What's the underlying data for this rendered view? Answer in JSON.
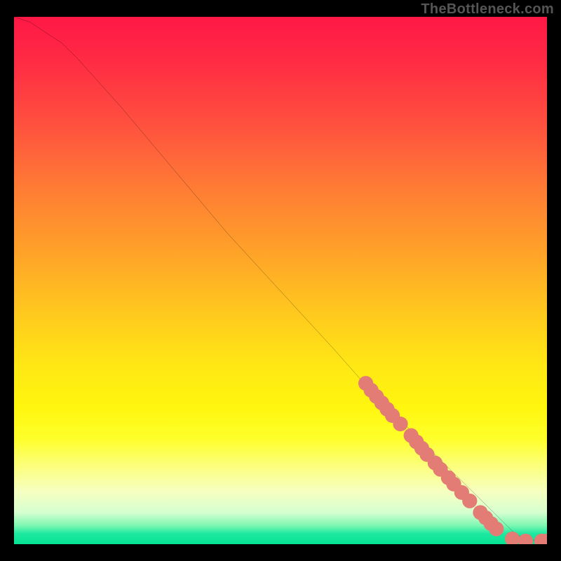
{
  "watermark": "TheBottleneck.com",
  "chart_data": {
    "type": "line",
    "title": "",
    "xlabel": "",
    "ylabel": "",
    "xlim": [
      0,
      100
    ],
    "ylim": [
      0,
      100
    ],
    "grid": false,
    "legend": false,
    "series": [
      {
        "name": "curve",
        "kind": "line",
        "color": "#000000",
        "x": [
          0,
          3,
          6,
          9,
          12,
          20,
          30,
          40,
          50,
          60,
          67,
          70,
          73,
          76,
          79,
          82,
          85,
          88,
          90,
          92,
          94,
          96,
          98,
          100
        ],
        "y": [
          100,
          99,
          97,
          95,
          92,
          83,
          71,
          59,
          48,
          37,
          29,
          26,
          23,
          20,
          17,
          14,
          11,
          8,
          6,
          4,
          2,
          1,
          0.6,
          0.6
        ]
      },
      {
        "name": "markers",
        "kind": "scatter",
        "color": "#e37c74",
        "points": [
          {
            "x": 66.0,
            "y": 30.5,
            "r": 1.4
          },
          {
            "x": 67.0,
            "y": 29.2,
            "r": 1.4
          },
          {
            "x": 68.0,
            "y": 28.0,
            "r": 1.4
          },
          {
            "x": 69.0,
            "y": 26.8,
            "r": 1.4
          },
          {
            "x": 70.0,
            "y": 25.6,
            "r": 1.4
          },
          {
            "x": 71.0,
            "y": 24.4,
            "r": 1.4
          },
          {
            "x": 72.5,
            "y": 22.8,
            "r": 1.4
          },
          {
            "x": 74.5,
            "y": 20.6,
            "r": 1.4
          },
          {
            "x": 75.5,
            "y": 19.4,
            "r": 1.4
          },
          {
            "x": 76.5,
            "y": 18.2,
            "r": 1.4
          },
          {
            "x": 77.5,
            "y": 17.0,
            "r": 1.4
          },
          {
            "x": 79.0,
            "y": 15.4,
            "r": 1.4
          },
          {
            "x": 80.0,
            "y": 14.2,
            "r": 1.4
          },
          {
            "x": 81.5,
            "y": 12.6,
            "r": 1.4
          },
          {
            "x": 82.5,
            "y": 11.4,
            "r": 1.4
          },
          {
            "x": 84.0,
            "y": 9.8,
            "r": 1.4
          },
          {
            "x": 85.5,
            "y": 8.2,
            "r": 1.4
          },
          {
            "x": 87.5,
            "y": 6.0,
            "r": 1.4
          },
          {
            "x": 88.5,
            "y": 5.0,
            "r": 1.4
          },
          {
            "x": 89.5,
            "y": 3.9,
            "r": 1.4
          },
          {
            "x": 90.5,
            "y": 2.9,
            "r": 1.4
          },
          {
            "x": 93.5,
            "y": 1.0,
            "r": 1.4
          },
          {
            "x": 96.0,
            "y": 0.6,
            "r": 1.4
          },
          {
            "x": 99.0,
            "y": 0.6,
            "r": 1.4
          },
          {
            "x": 100.0,
            "y": 0.6,
            "r": 1.4
          }
        ]
      }
    ]
  }
}
